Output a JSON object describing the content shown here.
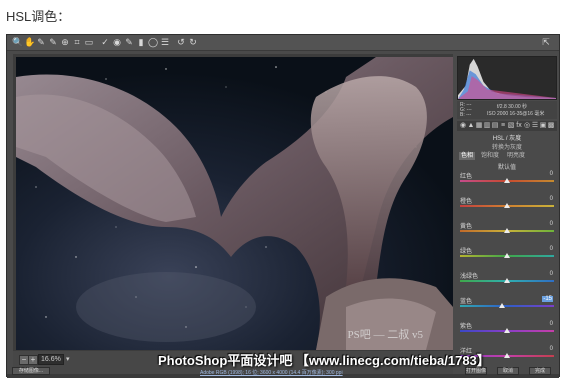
{
  "caption": "HSL调色：",
  "toolbar": {
    "tools": [
      {
        "name": "zoom-tool-icon",
        "glyph": "🔍"
      },
      {
        "name": "hand-tool-icon",
        "glyph": "✋"
      },
      {
        "name": "white-balance-tool-icon",
        "glyph": "✎"
      },
      {
        "name": "color-sampler-icon",
        "glyph": "✎"
      },
      {
        "name": "targeted-adjustment-icon",
        "glyph": "⊕"
      },
      {
        "name": "crop-tool-icon",
        "glyph": "⌗"
      },
      {
        "name": "straighten-tool-icon",
        "glyph": "▭"
      },
      {
        "name": "spot-removal-icon",
        "glyph": "✓"
      },
      {
        "name": "red-eye-icon",
        "glyph": "◉"
      },
      {
        "name": "adjustment-brush-icon",
        "glyph": "✎"
      },
      {
        "name": "graduated-filter-icon",
        "glyph": "▮"
      },
      {
        "name": "radial-filter-icon",
        "glyph": "◯"
      },
      {
        "name": "preferences-icon",
        "glyph": "☰"
      },
      {
        "name": "rotate-ccw-icon",
        "glyph": "↺"
      },
      {
        "name": "rotate-cw-icon",
        "glyph": "↻"
      }
    ]
  },
  "fullscreen_icon": "⇱",
  "readout": {
    "r": "R: ---",
    "g": "G: ---",
    "b": "B: ---",
    "exposure": "f/2.8  30.00 秒",
    "iso": "ISO 2000  16-35@16 毫米"
  },
  "panel_tabs": [
    "◉",
    "▲",
    "▦",
    "▥",
    "▤",
    "≡",
    "▧",
    "fx",
    "◎",
    "☰",
    "▣",
    "▩"
  ],
  "hsl": {
    "title": "HSL / 灰度",
    "subtitle": "转换为灰度",
    "tabs": [
      "色相",
      "饱和度",
      "明亮度"
    ],
    "active_tab": 0,
    "default_label": "默认值",
    "sliders": [
      {
        "label": "红色",
        "value": "0",
        "position": 0.5,
        "gradient": [
          "#c44b8a",
          "#c84a2f",
          "#c48a2f"
        ]
      },
      {
        "label": "橙色",
        "value": "0",
        "position": 0.5,
        "gradient": [
          "#c43f3f",
          "#d08030",
          "#c9b23a"
        ]
      },
      {
        "label": "黄色",
        "value": "0",
        "position": 0.5,
        "gradient": [
          "#c26a2a",
          "#c9b23a",
          "#6db33a"
        ]
      },
      {
        "label": "绿色",
        "value": "0",
        "position": 0.5,
        "gradient": [
          "#b4b32f",
          "#3fa84a",
          "#2fa8a0"
        ]
      },
      {
        "label": "浅绿色",
        "value": "0",
        "position": 0.5,
        "gradient": [
          "#3fa84a",
          "#2fb0b0",
          "#2f6ec4"
        ]
      },
      {
        "label": "蓝色",
        "value": "-15",
        "position": 0.45,
        "editing": true,
        "gradient": [
          "#2fa8b0",
          "#2f5ec8",
          "#7a3ec8"
        ]
      },
      {
        "label": "紫色",
        "value": "0",
        "position": 0.5,
        "gradient": [
          "#3a48c8",
          "#8a3ec8",
          "#c43ea8"
        ]
      },
      {
        "label": "洋红",
        "value": "0",
        "position": 0.5,
        "gradient": [
          "#8a3ec8",
          "#c43ea8",
          "#c43f4f"
        ]
      }
    ]
  },
  "status": {
    "zoom": "16.6%",
    "zoom_arrow": "▾"
  },
  "bottom": {
    "save_label": "存储图像...",
    "info": "Adobe RGB (1998); 16 位; 3600 x 4000 (14.4 百万像素); 300 ppi",
    "open_label": "打开图像",
    "cancel_label": "取消",
    "done_label": "完成"
  },
  "photo_watermark": "PS吧 — 二叔 v5",
  "overlay_watermark": "PhotoShop平面设计吧 【www.linecg.com/tieba/1783】"
}
